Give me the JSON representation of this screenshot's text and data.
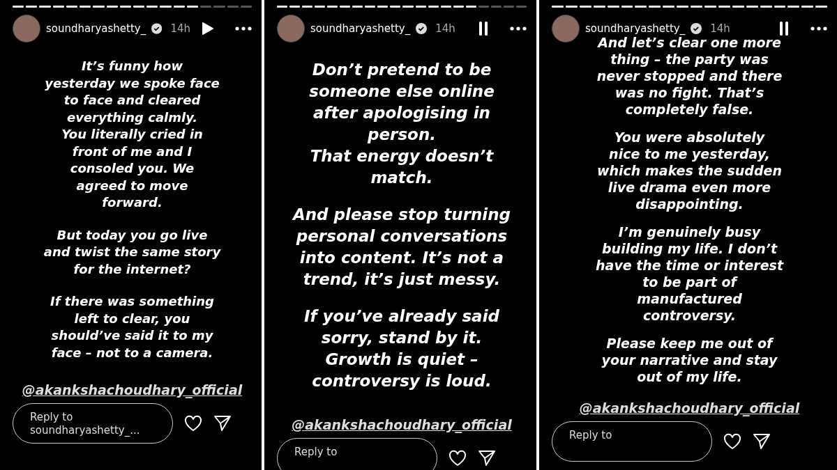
{
  "stories": [
    {
      "progress": [
        {
          "seen": true
        },
        {
          "seen": true
        },
        {
          "seen": true
        },
        {
          "seen": true
        },
        {
          "seen": true
        },
        {
          "seen": true
        },
        {
          "seen": true
        },
        {
          "seen": true
        },
        {
          "seen": true
        },
        {
          "seen": true
        },
        {
          "seen": true
        },
        {
          "seen": true
        },
        {
          "seen": true
        },
        {
          "seen": true
        },
        {
          "seen": false
        },
        {
          "seen": false
        },
        {
          "seen": false
        },
        {
          "seen": false
        }
      ],
      "username": "soundharyashetty_",
      "verified": true,
      "time": "14h",
      "paused": true,
      "paragraphs": [
        [
          "It’s funny how",
          "yesterday we spoke face",
          "to face and cleared",
          "everything calmly.",
          "You literally cried in",
          "front of me and I",
          "consoled you. We",
          "agreed to move",
          "forward."
        ],
        [
          "But today you go live",
          "and twist the same story",
          "for the internet?"
        ],
        [
          "If there was something",
          "left to clear, you",
          "should’ve said it to my",
          "face – not to a camera."
        ]
      ],
      "mention": "@akankshachoudhary_official",
      "reply": {
        "placeholder": "Reply to soundharyashetty_..."
      }
    },
    {
      "progress": [
        {
          "seen": true
        },
        {
          "seen": true
        },
        {
          "seen": true
        },
        {
          "seen": true
        },
        {
          "seen": true
        },
        {
          "seen": true
        },
        {
          "seen": true
        },
        {
          "seen": true
        },
        {
          "seen": true
        },
        {
          "seen": true
        },
        {
          "seen": true
        },
        {
          "seen": true
        },
        {
          "seen": true
        },
        {
          "seen": true
        },
        {
          "seen": true
        },
        {
          "seen": true
        },
        {
          "seen": false
        },
        {
          "seen": false
        },
        {
          "seen": false
        },
        {
          "seen": false
        }
      ],
      "username": "soundharyashetty_",
      "verified": true,
      "time": "14h",
      "paused": false,
      "paragraphs": [
        [
          "Don’t pretend to be",
          "someone else online",
          "after apologising in",
          "person.",
          "That energy doesn’t",
          "match."
        ],
        [
          "And please stop turning",
          "personal conversations",
          "into content. It’s not a",
          "trend, it’s just messy."
        ],
        [
          "If you’ve already said",
          "sorry, stand by it.",
          "Growth is quiet –",
          "controversy is loud."
        ]
      ],
      "mention": "@akankshachoudhary_official",
      "reply": {
        "placeholder": "Reply to"
      }
    },
    {
      "progress": [
        {
          "seen": true
        },
        {
          "seen": true
        },
        {
          "seen": true
        },
        {
          "seen": true
        },
        {
          "seen": true
        },
        {
          "seen": true
        },
        {
          "seen": true
        },
        {
          "seen": true
        },
        {
          "seen": true
        },
        {
          "seen": true
        },
        {
          "seen": true
        },
        {
          "seen": true
        },
        {
          "seen": true
        },
        {
          "seen": true
        },
        {
          "seen": true
        },
        {
          "seen": true
        },
        {
          "seen": true
        },
        {
          "seen": true
        },
        {
          "seen": true
        },
        {
          "seen": true
        }
      ],
      "username": "soundharyashetty_",
      "verified": true,
      "time": "14h",
      "paused": false,
      "paragraphs": [
        [
          "And let’s clear one more",
          "thing – the party was",
          "never stopped and there",
          "was no fight. That’s",
          "completely false."
        ],
        [
          "You were absolutely",
          "nice to me yesterday,",
          "which makes the sudden",
          "live drama even more",
          "disappointing."
        ],
        [
          "I’m genuinely busy",
          "building my life. I don’t",
          "have the time or interest",
          "to be part of",
          "manufactured",
          "controversy."
        ],
        [
          "Please keep me out of",
          "your narrative and stay",
          "out of my life."
        ]
      ],
      "mention": "@akankshachoudhary_official",
      "reply": {
        "placeholder": "Reply to"
      }
    }
  ]
}
